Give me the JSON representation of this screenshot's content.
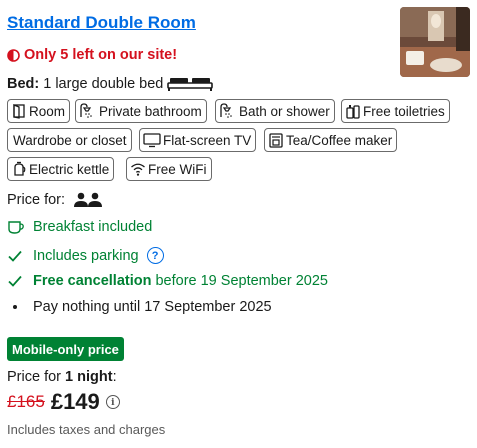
{
  "room": {
    "title": "Standard Double Room",
    "scarcity": "Only 5 left on our site!",
    "bed_label": "Bed:",
    "bed_value": "1 large double bed"
  },
  "amenities": [
    {
      "label": "Room",
      "icon": "room-icon"
    },
    {
      "label": "Private bathroom",
      "icon": "shower-icon"
    },
    {
      "label": "Bath or shower",
      "icon": "shower-icon"
    },
    {
      "label": "Free toiletries",
      "icon": "toiletries-icon"
    },
    {
      "label": "Wardrobe or closet",
      "icon": ""
    },
    {
      "label": "Flat-screen TV",
      "icon": "tv-icon"
    },
    {
      "label": "Tea/Coffee maker",
      "icon": "coffee-maker-icon"
    },
    {
      "label": "Electric kettle",
      "icon": "kettle-icon"
    },
    {
      "label": "Free WiFi",
      "icon": "wifi-icon"
    }
  ],
  "occupancy": {
    "label": "Price for:",
    "icon": "two-persons-icon"
  },
  "features": {
    "breakfast": "Breakfast included",
    "parking": "Includes parking",
    "cancellation_bold": "Free cancellation",
    "cancellation_rest": "before 19 September 2025",
    "pay_nothing": "Pay nothing until 17 September 2025"
  },
  "pricing": {
    "badge": "Mobile-only price",
    "night_prefix": "Price for",
    "night_bold": "1 night",
    "night_suffix": ":",
    "old_price": "£165",
    "new_price": "£149",
    "taxes_note": "Includes taxes and charges"
  },
  "colors": {
    "link_blue": "#006ce4",
    "urgent_red": "#d4111e",
    "success_green": "#008234"
  }
}
